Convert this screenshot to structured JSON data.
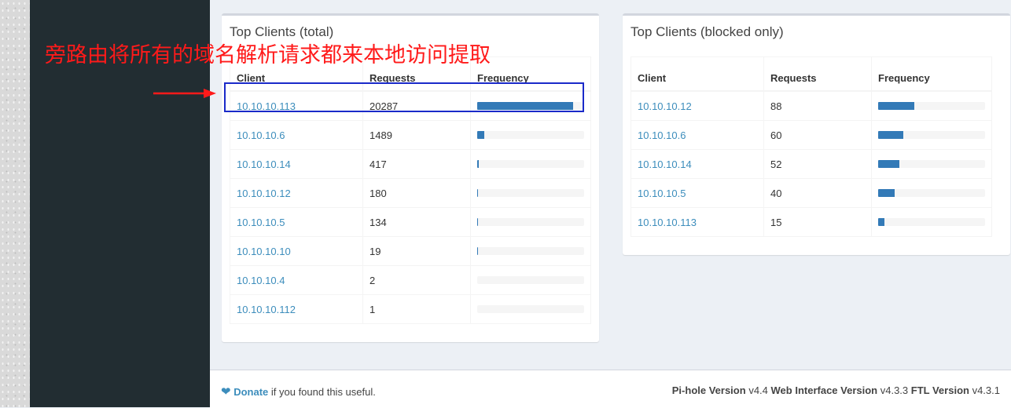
{
  "total_clients": {
    "title": "Top Clients (total)",
    "headers": {
      "client": "Client",
      "requests": "Requests",
      "frequency": "Frequency"
    },
    "rows": [
      {
        "client": "10.10.10.113",
        "requests": "20287",
        "frequency": 0.9
      },
      {
        "client": "10.10.10.6",
        "requests": "1489",
        "frequency": 0.066
      },
      {
        "client": "10.10.10.14",
        "requests": "417",
        "frequency": 0.018
      },
      {
        "client": "10.10.10.12",
        "requests": "180",
        "frequency": 0.008
      },
      {
        "client": "10.10.10.5",
        "requests": "134",
        "frequency": 0.006
      },
      {
        "client": "10.10.10.10",
        "requests": "19",
        "frequency": 0.001
      },
      {
        "client": "10.10.10.4",
        "requests": "2",
        "frequency": 0.0
      },
      {
        "client": "10.10.10.112",
        "requests": "1",
        "frequency": 0.0
      }
    ]
  },
  "blocked_clients": {
    "title": "Top Clients (blocked only)",
    "headers": {
      "client": "Client",
      "requests": "Requests",
      "frequency": "Frequency"
    },
    "rows": [
      {
        "client": "10.10.10.12",
        "requests": "88",
        "frequency": 0.34
      },
      {
        "client": "10.10.10.6",
        "requests": "60",
        "frequency": 0.235
      },
      {
        "client": "10.10.10.14",
        "requests": "52",
        "frequency": 0.2
      },
      {
        "client": "10.10.10.5",
        "requests": "40",
        "frequency": 0.155
      },
      {
        "client": "10.10.10.113",
        "requests": "15",
        "frequency": 0.058
      }
    ]
  },
  "annotation": {
    "text": "旁路由将所有的域名解析请求都来本地访问提取",
    "color": "#ff1a1a",
    "highlight_color": "#1a2ac9"
  },
  "footer": {
    "heart_icon": "heart-icon",
    "donate_label": "Donate",
    "donate_suffix": "if you found this useful.",
    "pihole_label": "Pi-hole Version",
    "pihole_version": "v4.4",
    "web_label": "Web Interface Version",
    "web_version": "v4.3.3",
    "ftl_label": "FTL Version",
    "ftl_version": "v4.3.1"
  },
  "colors": {
    "sidebar": "#222d32",
    "link": "#3c8dbc",
    "bar": "#337ab7"
  }
}
